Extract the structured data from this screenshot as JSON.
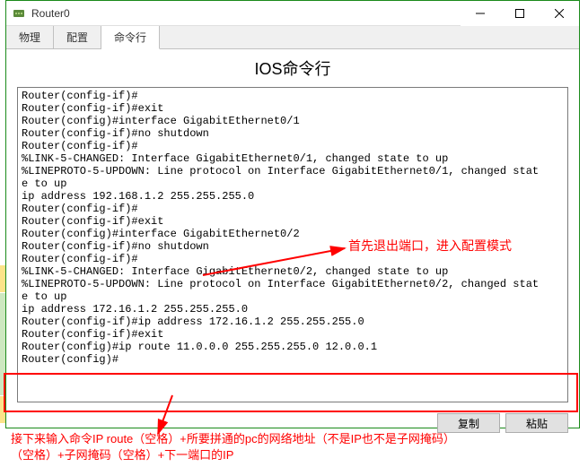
{
  "window": {
    "title": "Router0"
  },
  "tabs": {
    "t0": "物理",
    "t1": "配置",
    "t2": "命令行"
  },
  "panel": {
    "title": "IOS命令行"
  },
  "buttons": {
    "copy": "复制",
    "paste": "粘贴"
  },
  "terminal": {
    "l0": "Router(config-if)#",
    "l1": "Router(config-if)#exit",
    "l2": "Router(config)#interface GigabitEthernet0/1",
    "l3": "Router(config-if)#no shutdown",
    "l4": "",
    "l5": "Router(config-if)#",
    "l6": "%LINK-5-CHANGED: Interface GigabitEthernet0/1, changed state to up",
    "l7": "",
    "l8": "%LINEPROTO-5-UPDOWN: Line protocol on Interface GigabitEthernet0/1, changed stat",
    "l9": "e to up",
    "l10": "ip address 192.168.1.2 255.255.255.0",
    "l11": "Router(config-if)#",
    "l12": "Router(config-if)#exit",
    "l13": "Router(config)#interface GigabitEthernet0/2",
    "l14": "Router(config-if)#no shutdown",
    "l15": "",
    "l16": "Router(config-if)#",
    "l17": "%LINK-5-CHANGED: Interface GigabitEthernet0/2, changed state to up",
    "l18": "",
    "l19": "%LINEPROTO-5-UPDOWN: Line protocol on Interface GigabitEthernet0/2, changed stat",
    "l20": "e to up",
    "l21": "ip address 172.16.1.2 255.255.255.0",
    "l22": "Router(config-if)#ip address 172.16.1.2 255.255.255.0",
    "l23": "Router(config-if)#exit",
    "l24": "Router(config)#ip route 11.0.0.0 255.255.255.0 12.0.0.1",
    "l25": "Router(config)#"
  },
  "annotations": {
    "a1": "首先退出端口，进入配置模式",
    "a2a": "接下来输入命令IP route（空格）+所要拼通的pc的网络地址（不是IP也不是子网掩码）",
    "a2b": "（空格）+子网掩码（空格）+下一端口的IP"
  }
}
